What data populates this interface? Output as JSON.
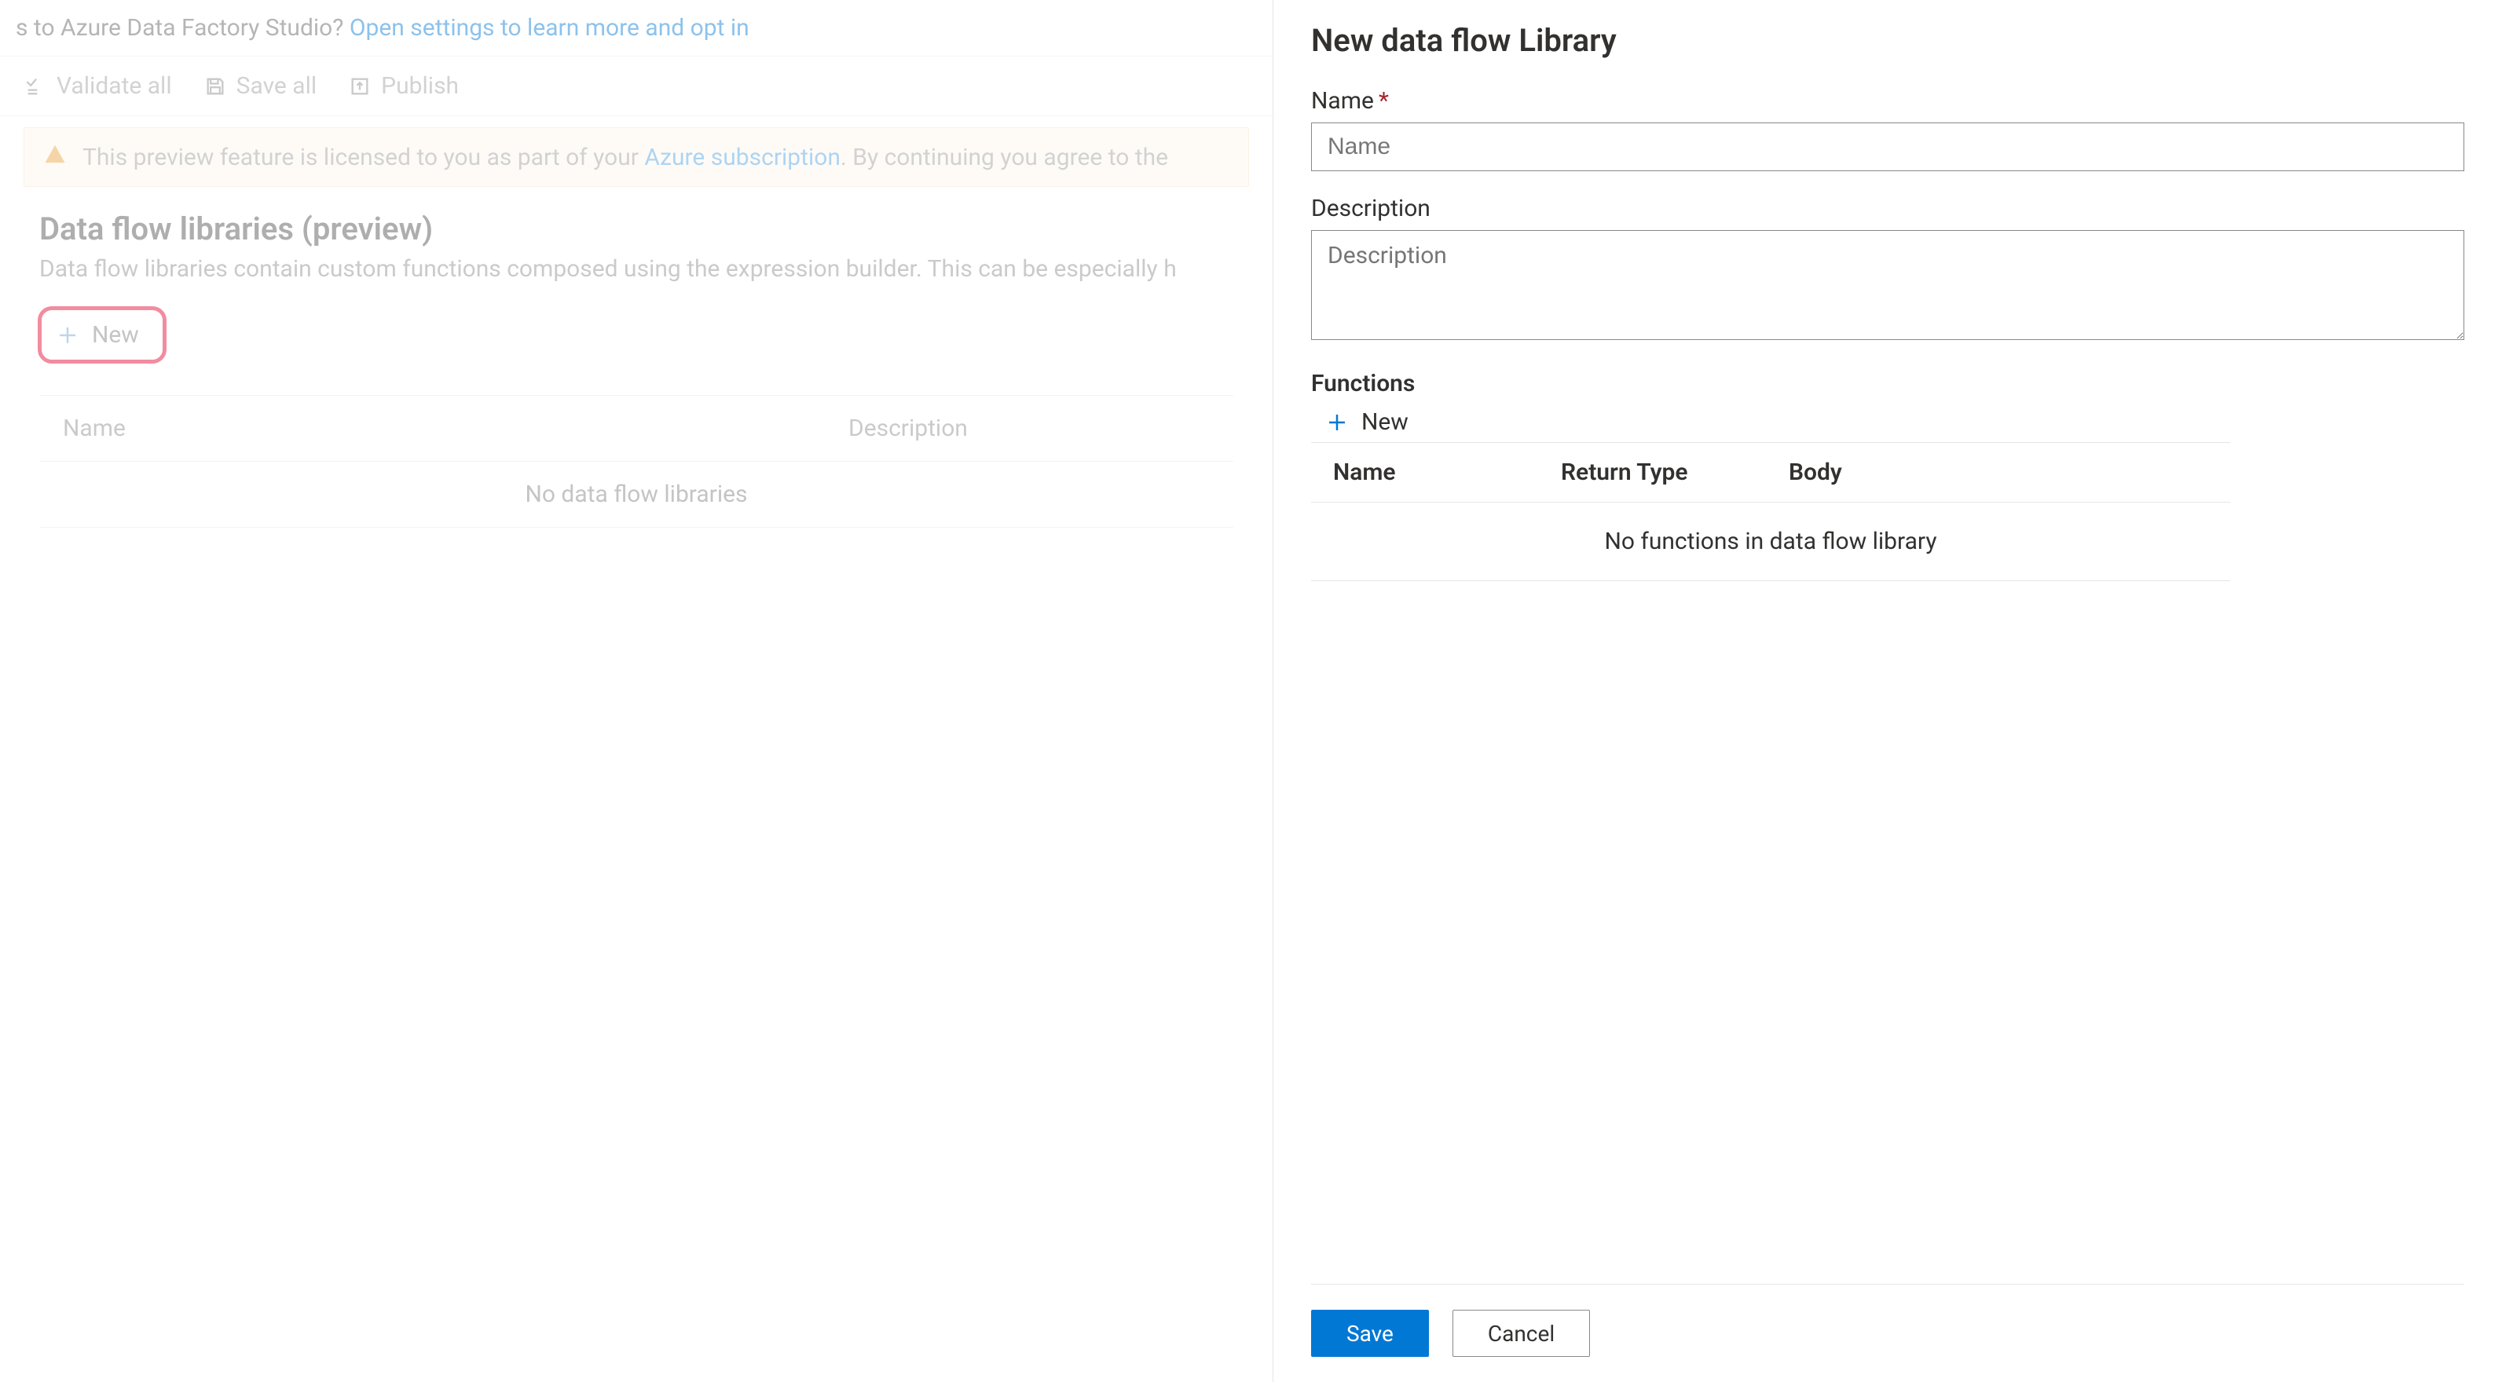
{
  "top_banner": {
    "prefix": "s to Azure Data Factory Studio? ",
    "link": "Open settings to learn more and opt in"
  },
  "toolbar": {
    "validate_all": "Validate all",
    "save_all": "Save all",
    "publish": "Publish"
  },
  "preview_notice": {
    "prefix": "This preview feature is licensed to you as part of your ",
    "link": "Azure subscription",
    "suffix": ". By continuing you agree to the"
  },
  "page": {
    "title": "Data flow libraries (preview)",
    "description": "Data flow libraries contain custom functions composed using the expression builder. This can be especially h",
    "new_button": "New"
  },
  "libraries_table": {
    "columns": {
      "name": "Name",
      "description": "Description"
    },
    "empty": "No data flow libraries "
  },
  "panel": {
    "title": "New data flow Library",
    "name_label": "Name",
    "name_placeholder": "Name",
    "description_label": "Description",
    "description_placeholder": "Description",
    "functions_label": "Functions",
    "functions_new": "New",
    "functions_columns": {
      "name": "Name",
      "return_type": "Return Type",
      "body": "Body"
    },
    "functions_empty": "No functions in data flow library",
    "save": "Save",
    "cancel": "Cancel"
  }
}
